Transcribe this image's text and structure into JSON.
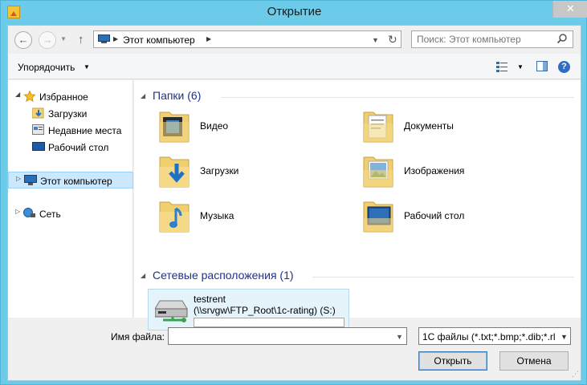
{
  "window": {
    "title": "Открытие",
    "close_symbol": "✕"
  },
  "address_bar": {
    "path": "Этот компьютер",
    "sep": "▶"
  },
  "search": {
    "placeholder": "Поиск: Этот компьютер"
  },
  "toolbar": {
    "organize_label": "Упорядочить"
  },
  "nav_pane": {
    "favorites": "Избранное",
    "downloads": "Загрузки",
    "recent": "Недавние места",
    "desktop": "Рабочий стол",
    "this_pc": "Этот компьютер",
    "network": "Сеть"
  },
  "main": {
    "folders_header": "Папки (6)",
    "folders": [
      {
        "label": "Видео",
        "icon": "video-folder-icon"
      },
      {
        "label": "Документы",
        "icon": "documents-folder-icon"
      },
      {
        "label": "Загрузки",
        "icon": "downloads-folder-icon"
      },
      {
        "label": "Изображения",
        "icon": "pictures-folder-icon"
      },
      {
        "label": "Музыка",
        "icon": "music-folder-icon"
      },
      {
        "label": "Рабочий стол",
        "icon": "desktop-folder-icon"
      }
    ],
    "network_header": "Сетевые расположения (1)",
    "network_item": {
      "name": "testrent",
      "path": "(\\\\srvgw\\FTP_Root\\1c-rating) (S:)"
    }
  },
  "bottom": {
    "filename_label": "Имя файла:",
    "filename_value": "",
    "filter_value": "1С файлы (*.txt;*.bmp;*.dib;*.rl",
    "open_label": "Открыть",
    "cancel_label": "Отмена"
  }
}
